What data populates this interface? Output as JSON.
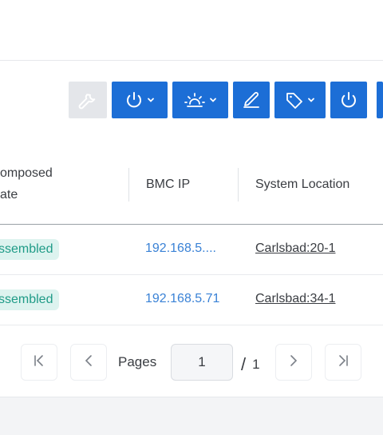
{
  "toolbar": {
    "buttons": [
      {
        "icon": "wrench-icon",
        "disabled": true,
        "dropdown": false
      },
      {
        "icon": "power-icon",
        "disabled": false,
        "dropdown": true
      },
      {
        "icon": "alarm-light-icon",
        "disabled": false,
        "dropdown": true
      },
      {
        "icon": "pencil-icon",
        "disabled": false,
        "dropdown": false
      },
      {
        "icon": "tag-icon",
        "disabled": false,
        "dropdown": true
      },
      {
        "icon": "power-icon",
        "disabled": false,
        "dropdown": false
      }
    ]
  },
  "table": {
    "headers": {
      "composed_state_line1": "omposed",
      "composed_state_line2": "ate",
      "bmc_ip": "BMC IP",
      "system_location": "System Location"
    },
    "rows": [
      {
        "state": "ssembled",
        "bmc_ip": "192.168.5....",
        "location": "Carlsbad:20-1"
      },
      {
        "state": "ssembled",
        "bmc_ip": "192.168.5.71",
        "location": "Carlsbad:34-1"
      }
    ]
  },
  "pagination": {
    "pages_label": "Pages",
    "current_page": "1",
    "total_pages": "1",
    "separator": "/"
  },
  "colors": {
    "primary": "#1c6ed6",
    "badge_bg": "#ddf3ef",
    "badge_text": "#1f9b87",
    "link": "#3a82d6"
  }
}
